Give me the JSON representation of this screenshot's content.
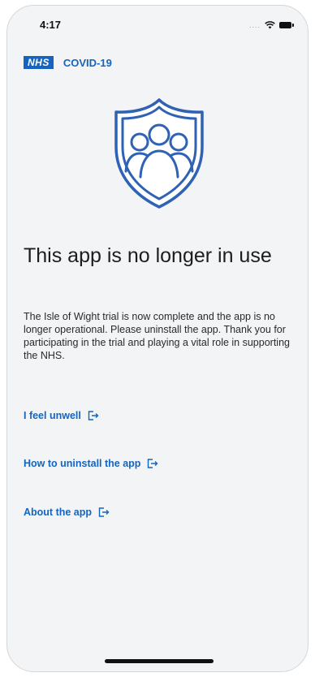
{
  "status_bar": {
    "time": "4:17",
    "signal": "....",
    "icons": [
      "wifi-icon",
      "battery-icon"
    ]
  },
  "brand": {
    "logo_text": "NHS",
    "app_name": "COVID-19",
    "color": "#1565c0"
  },
  "illustration": {
    "icon": "shield-people-icon"
  },
  "main": {
    "title": "This app is no longer in use",
    "description": "The Isle of Wight trial is now complete and the app is no longer operational. Please uninstall the app. Thank you for participating in the trial and playing a vital role in supporting the NHS."
  },
  "links": [
    {
      "label": "I feel unwell",
      "icon": "external-link-icon"
    },
    {
      "label": "How to uninstall the app",
      "icon": "external-link-icon"
    },
    {
      "label": "About the app",
      "icon": "external-link-icon"
    }
  ]
}
